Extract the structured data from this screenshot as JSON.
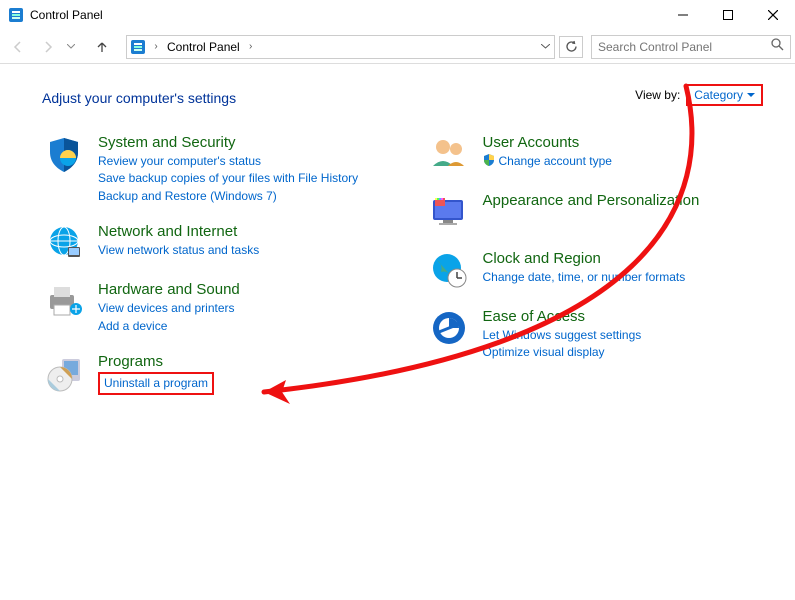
{
  "window": {
    "title": "Control Panel"
  },
  "breadcrumb": {
    "root": "Control Panel"
  },
  "search": {
    "placeholder": "Search Control Panel"
  },
  "header": {
    "title": "Adjust your computer's settings",
    "viewby_label": "View by:",
    "viewby_value": "Category"
  },
  "categories_left": [
    {
      "name": "system-security",
      "title": "System and Security",
      "links": [
        {
          "text": "Review your computer's status"
        },
        {
          "text": "Save backup copies of your files with File History"
        },
        {
          "text": "Backup and Restore (Windows 7)"
        }
      ]
    },
    {
      "name": "network-internet",
      "title": "Network and Internet",
      "links": [
        {
          "text": "View network status and tasks"
        }
      ]
    },
    {
      "name": "hardware-sound",
      "title": "Hardware and Sound",
      "links": [
        {
          "text": "View devices and printers"
        },
        {
          "text": "Add a device"
        }
      ]
    },
    {
      "name": "programs",
      "title": "Programs",
      "links": [
        {
          "text": "Uninstall a program",
          "highlight": true
        }
      ]
    }
  ],
  "categories_right": [
    {
      "name": "user-accounts",
      "title": "User Accounts",
      "links": [
        {
          "text": "Change account type",
          "shield": true
        }
      ]
    },
    {
      "name": "appearance-personalization",
      "title": "Appearance and Personalization",
      "links": []
    },
    {
      "name": "clock-region",
      "title": "Clock and Region",
      "links": [
        {
          "text": "Change date, time, or number formats"
        }
      ]
    },
    {
      "name": "ease-of-access",
      "title": "Ease of Access",
      "links": [
        {
          "text": "Let Windows suggest settings"
        },
        {
          "text": "Optimize visual display"
        }
      ]
    }
  ]
}
